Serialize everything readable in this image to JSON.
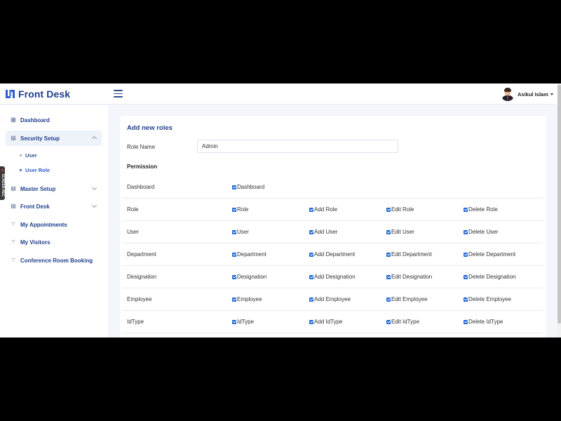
{
  "header": {
    "logo_text": "Front Desk",
    "user_name": "Asikul Islam"
  },
  "sidebar": {
    "items": [
      {
        "label": "Dashboard",
        "icon": "grid-icon"
      },
      {
        "label": "Security Setup",
        "icon": "table-icon",
        "expanded": true
      },
      {
        "label": "Master Setup",
        "icon": "table-icon"
      },
      {
        "label": "Front Desk",
        "icon": "table-icon"
      },
      {
        "label": "My Appointments",
        "icon": "signal-icon"
      },
      {
        "label": "My Visitors",
        "icon": "signal-icon"
      },
      {
        "label": "Conference Room Booking",
        "icon": "signal-icon"
      }
    ],
    "sub_items": [
      {
        "label": "User"
      },
      {
        "label": "User Role",
        "active": true
      }
    ]
  },
  "screen_recorder_tab": "SCREEN REC",
  "form": {
    "title": "Add new roles",
    "role_name_label": "Role Name",
    "role_name_value": "Admin",
    "permission_heading": "Permission"
  },
  "permissions": [
    {
      "name": "Dashboard",
      "options": [
        "Dashboard"
      ]
    },
    {
      "name": "Role",
      "options": [
        "Role",
        "Add Role",
        "Edit Role",
        "Delete Role"
      ]
    },
    {
      "name": "User",
      "options": [
        "User",
        "Add User",
        "Edit User",
        "Delete User"
      ]
    },
    {
      "name": "Department",
      "options": [
        "Department",
        "Add Department",
        "Edit Department",
        "Delete Department"
      ]
    },
    {
      "name": "Designation",
      "options": [
        "Designation",
        "Add Designation",
        "Edit Designation",
        "Delete Designation"
      ]
    },
    {
      "name": "Employee",
      "options": [
        "Employee",
        "Add Employee",
        "Edit Employee",
        "Delete Employee"
      ]
    },
    {
      "name": "IdType",
      "options": [
        "IdType",
        "Add IdType",
        "Edit IdType",
        "Delete IdType"
      ]
    }
  ],
  "colors": {
    "brand": "#1f3f8f",
    "accent": "#2f5bd3",
    "checkbox": "#1a66d6"
  }
}
